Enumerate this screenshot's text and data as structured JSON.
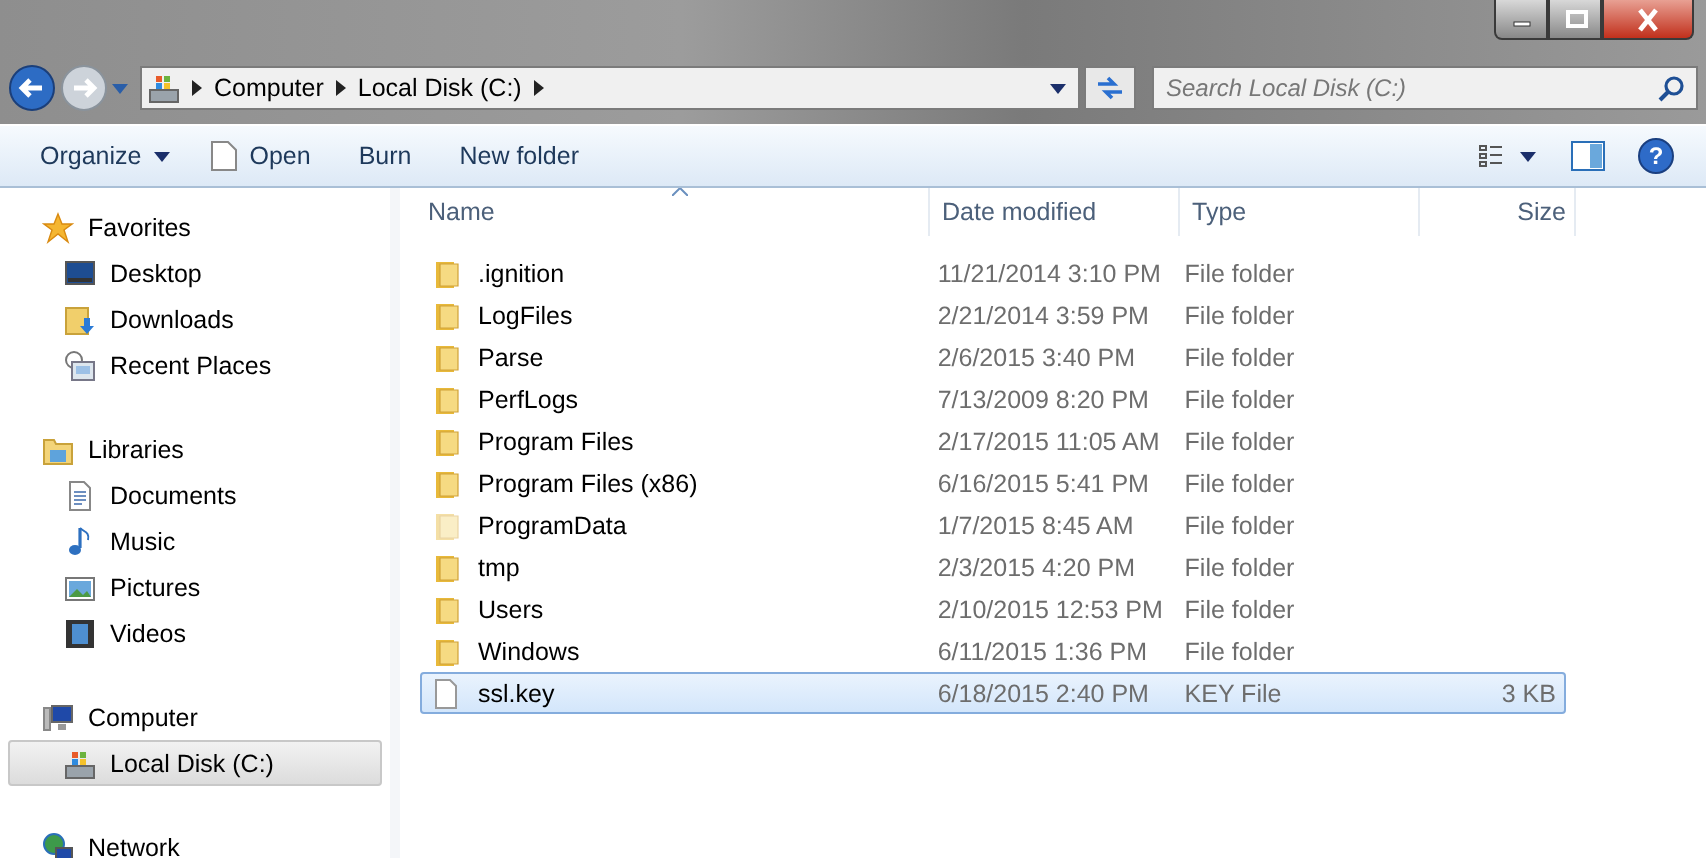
{
  "address": {
    "crumbs": [
      "Computer",
      "Local Disk (C:)"
    ]
  },
  "search": {
    "placeholder": "Search Local Disk (C:)"
  },
  "toolbar": {
    "buttons": [
      {
        "label": "Organize",
        "dropdown": true
      },
      {
        "label": "Open",
        "dropdown": false
      },
      {
        "label": "Burn",
        "dropdown": false
      },
      {
        "label": "New folder",
        "dropdown": false
      }
    ]
  },
  "sidebar": {
    "groups": [
      {
        "label": "Favorites",
        "selected": false,
        "children": [
          {
            "label": "Desktop",
            "selected": false
          },
          {
            "label": "Downloads",
            "selected": false
          },
          {
            "label": "Recent Places",
            "selected": false
          }
        ]
      },
      {
        "label": "Libraries",
        "selected": false,
        "children": [
          {
            "label": "Documents",
            "selected": false
          },
          {
            "label": "Music",
            "selected": false
          },
          {
            "label": "Pictures",
            "selected": false
          },
          {
            "label": "Videos",
            "selected": false
          }
        ]
      },
      {
        "label": "Computer",
        "selected": false,
        "children": [
          {
            "label": "Local Disk (C:)",
            "selected": true
          }
        ]
      },
      {
        "label": "Network",
        "selected": false
      }
    ]
  },
  "help_button": {
    "label": "?"
  },
  "table": {
    "columns": [
      "Name",
      "Date modified",
      "Type",
      "Size"
    ],
    "rows": [
      {
        "kind": "folder",
        "name": ".ignition",
        "date": "11/21/2014 3:10 PM",
        "type": "File folder",
        "hidden": false,
        "selected": false
      },
      {
        "kind": "folder",
        "name": "LogFiles",
        "date": "2/21/2014 3:59 PM",
        "type": "File folder",
        "hidden": false,
        "selected": false
      },
      {
        "kind": "folder",
        "name": "Parse",
        "date": "2/6/2015 3:40 PM",
        "type": "File folder",
        "hidden": false,
        "selected": false
      },
      {
        "kind": "folder",
        "name": "PerfLogs",
        "date": "7/13/2009 8:20 PM",
        "type": "File folder",
        "hidden": false,
        "selected": false
      },
      {
        "kind": "folder",
        "name": "Program Files",
        "date": "2/17/2015 11:05 AM",
        "type": "File folder",
        "hidden": false,
        "selected": false
      },
      {
        "kind": "folder",
        "name": "Program Files (x86)",
        "date": "6/16/2015 5:41 PM",
        "type": "File folder",
        "hidden": false,
        "selected": false
      },
      {
        "kind": "folder",
        "name": "ProgramData",
        "date": "1/7/2015 8:45 AM",
        "type": "File folder",
        "hidden": true,
        "selected": false
      },
      {
        "kind": "folder",
        "name": "tmp",
        "date": "2/3/2015 4:20 PM",
        "type": "File folder",
        "hidden": false,
        "selected": false
      },
      {
        "kind": "folder",
        "name": "Users",
        "date": "2/10/2015 12:53 PM",
        "type": "File folder",
        "hidden": false,
        "selected": false
      },
      {
        "kind": "folder",
        "name": "Windows",
        "date": "6/11/2015 1:36 PM",
        "type": "File folder",
        "hidden": false,
        "selected": false
      },
      {
        "kind": "file",
        "name": "ssl.key",
        "date": "6/18/2015 2:40 PM",
        "type": "KEY File",
        "size": "3 KB",
        "hidden": false,
        "selected": true
      }
    ]
  }
}
